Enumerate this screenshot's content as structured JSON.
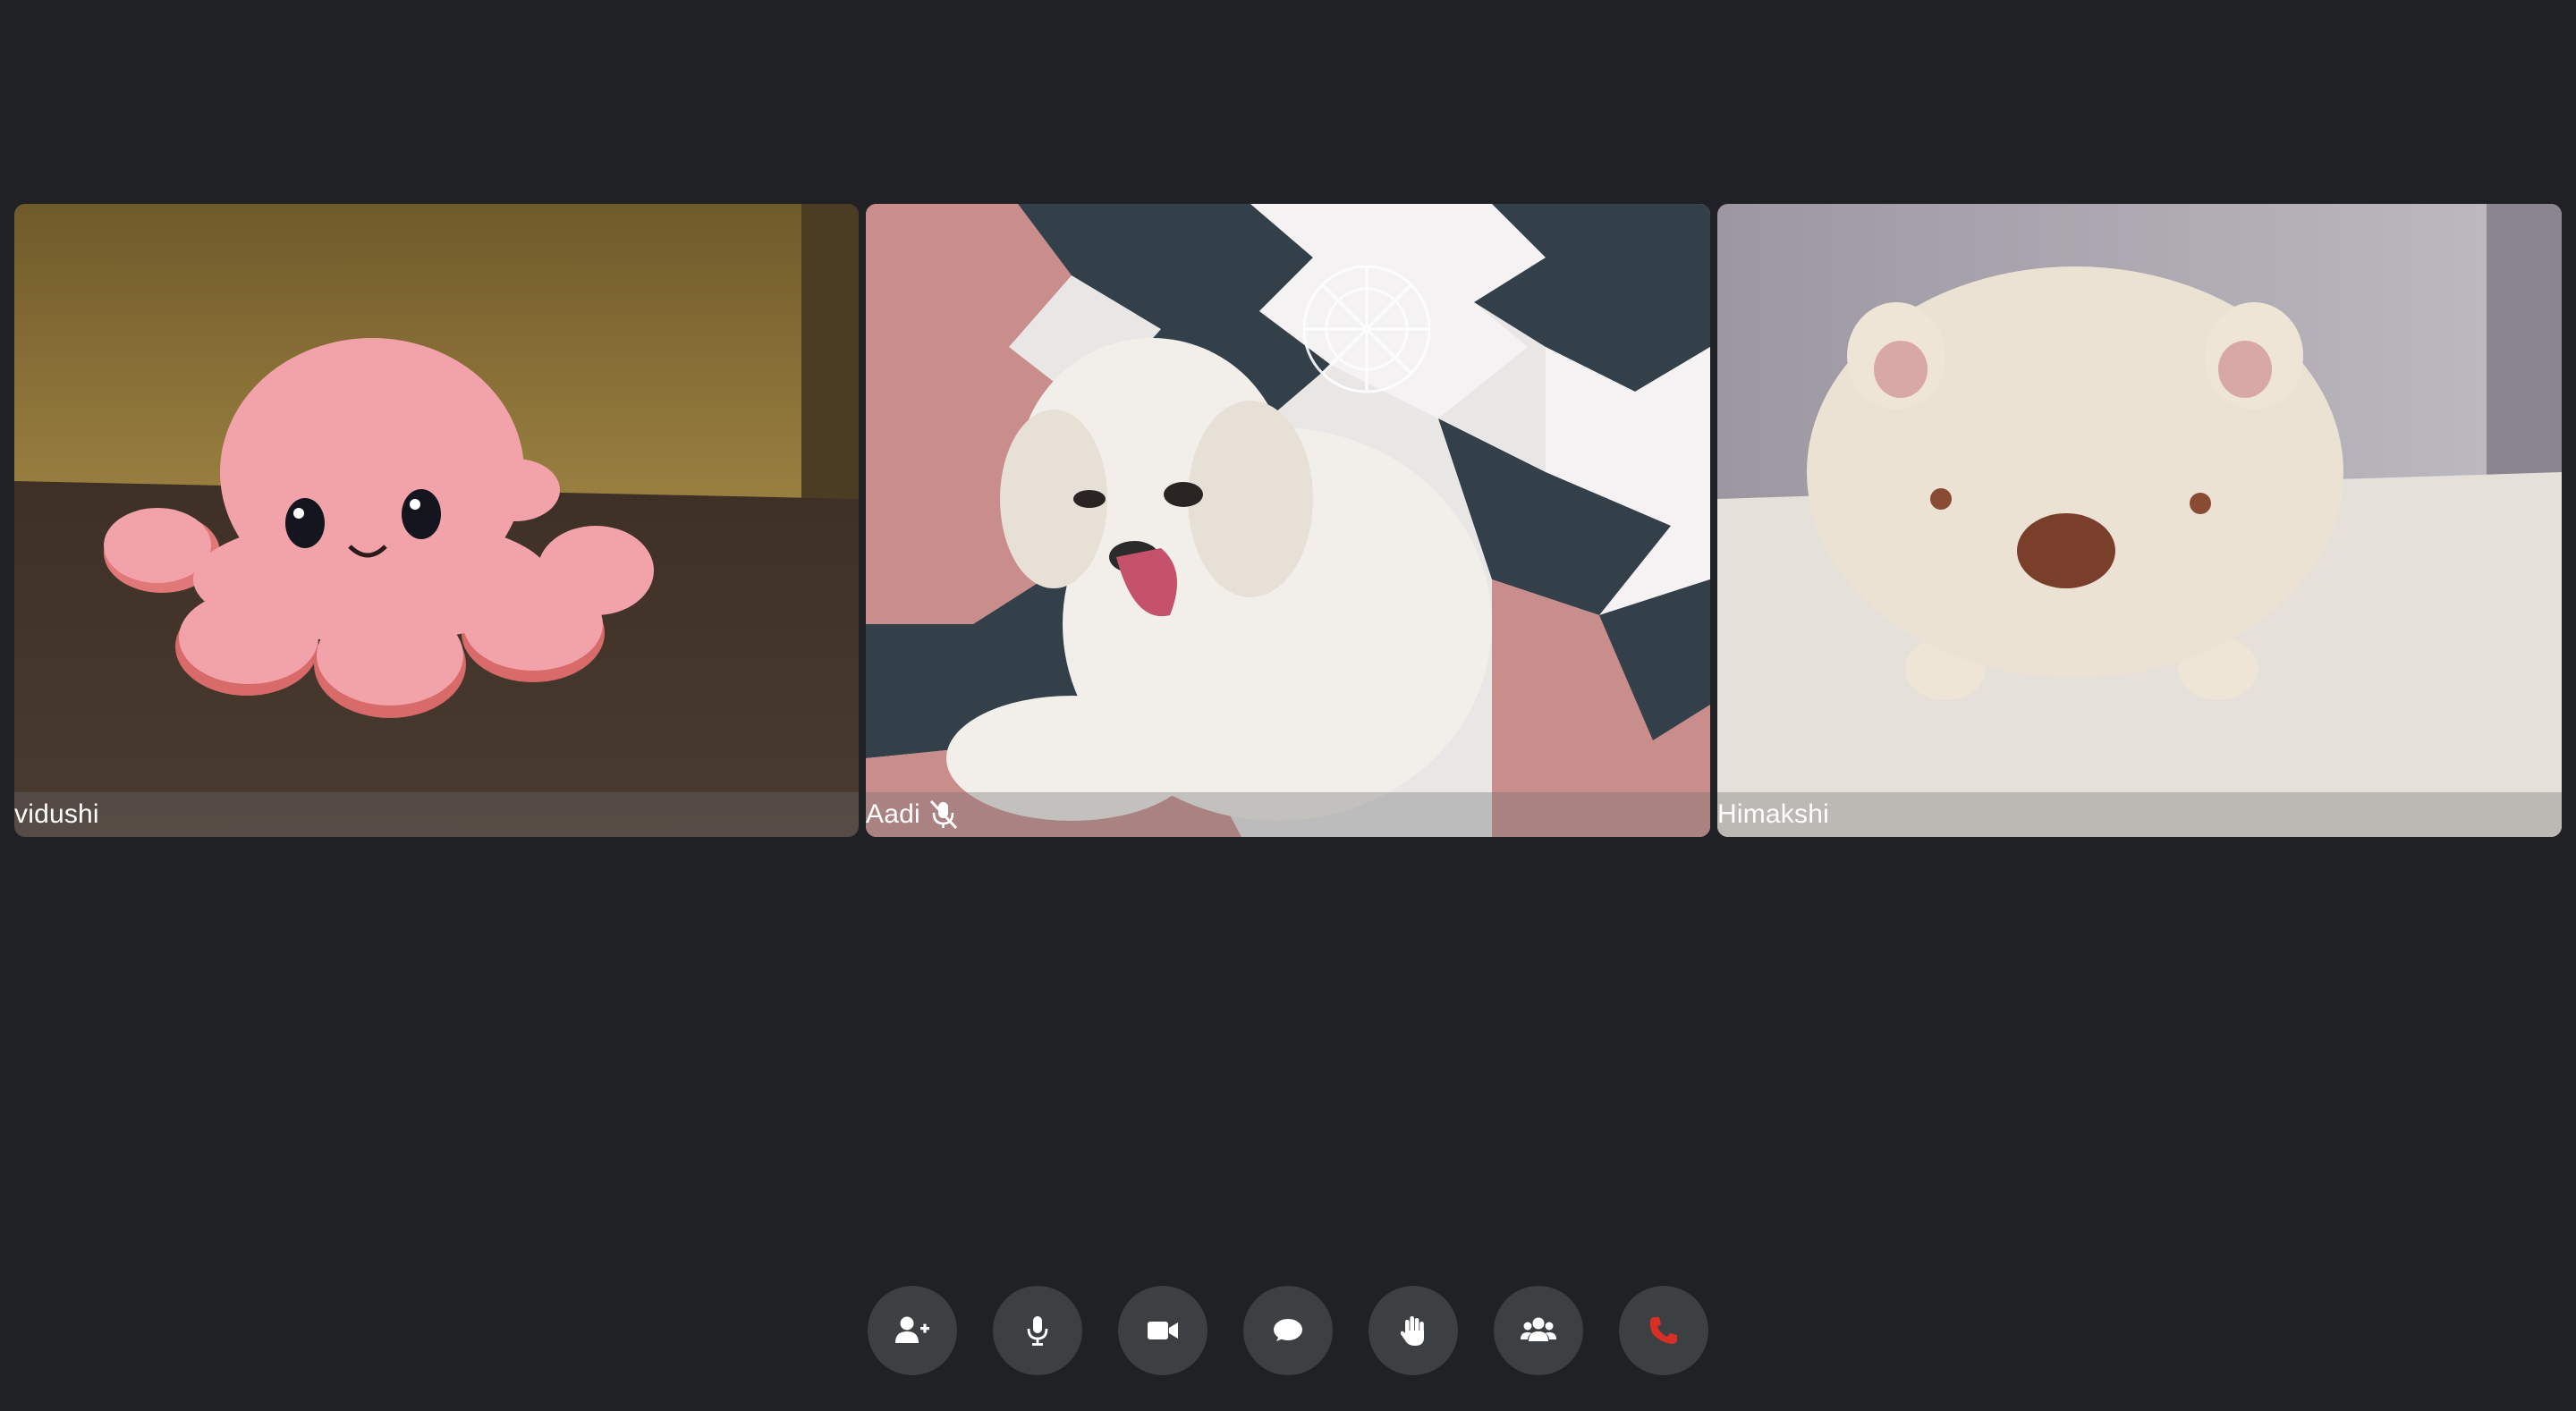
{
  "participants": [
    {
      "name": "vidushi",
      "muted": false,
      "video_subject": "pink-octopus-plush"
    },
    {
      "name": "Aadi",
      "muted": true,
      "video_subject": "white-dog"
    },
    {
      "name": "Himakshi",
      "muted": false,
      "video_subject": "bear-plush"
    }
  ],
  "controls": [
    {
      "icon": "add-person-icon",
      "action": "invite"
    },
    {
      "icon": "microphone-icon",
      "action": "toggle-mic"
    },
    {
      "icon": "video-camera-icon",
      "action": "toggle-camera"
    },
    {
      "icon": "chat-bubble-icon",
      "action": "chat"
    },
    {
      "icon": "raise-hand-icon",
      "action": "raise-hand"
    },
    {
      "icon": "participants-icon",
      "action": "participants"
    },
    {
      "icon": "end-call-icon",
      "action": "hang-up"
    }
  ],
  "colors": {
    "background": "#202124",
    "control_button": "#3c4043",
    "icon": "#ffffff",
    "end_call": "#d93025"
  }
}
